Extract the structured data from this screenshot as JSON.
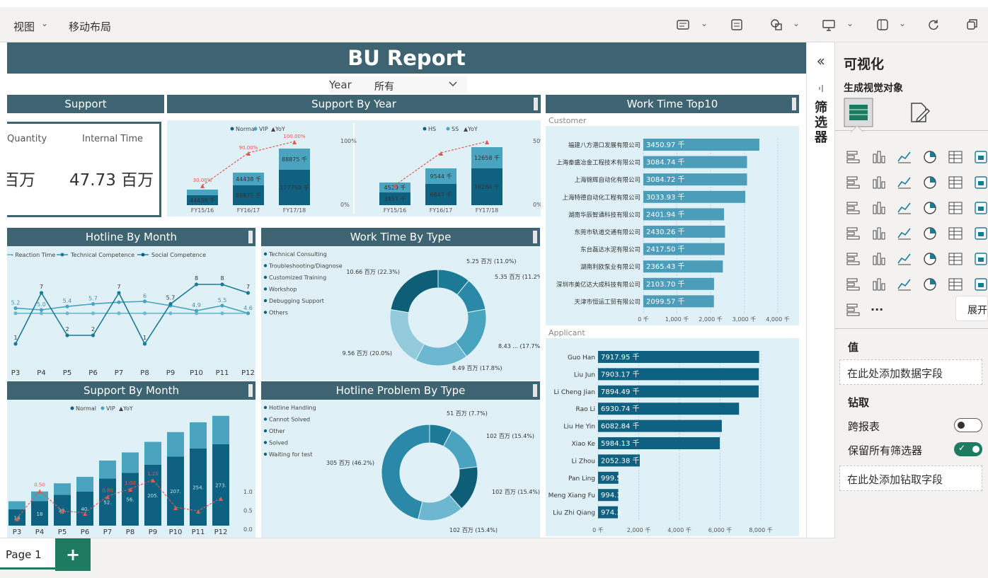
{
  "toolbar": {
    "view_label": "视图",
    "mobile_layout_label": "移动布局"
  },
  "report": {
    "title": "BU Report",
    "slicer": {
      "label": "Year",
      "value": "所有"
    }
  },
  "support_card": {
    "header": "Support",
    "quantity_label": "Quantity",
    "quantity_value": "百万",
    "internal_label": "Internal Time",
    "internal_value": "47.73 百万"
  },
  "support_by_year": {
    "header": "Support By Year",
    "left": {
      "legend": [
        "Normal",
        "VIP",
        "YoY"
      ],
      "axis_right": [
        "100%",
        "0%"
      ],
      "bar_labels_top": [
        "",
        "44438 千",
        "88875 千"
      ],
      "bar_labels_bottom": [
        "44438 千",
        "88875 千",
        "177750 千"
      ],
      "yoy_labels": [
        "30.00%",
        "90.00%",
        "100.00%"
      ],
      "categories": [
        "FY15/16",
        "FY16/17",
        "FY17/18"
      ]
    },
    "right": {
      "legend": [
        "HS",
        "SS",
        "YoY"
      ],
      "axis_right": [
        "50%",
        "0%"
      ],
      "bar_labels_top": [
        "4529 千",
        "9544 千",
        "12658 千"
      ],
      "bar_labels_bottom": [
        "3457 千",
        "6847 千",
        "10284 千"
      ],
      "categories": [
        "FY15/16",
        "FY16/17",
        "FY17/18"
      ]
    }
  },
  "worktime_top10": {
    "header": "Work Time Top10",
    "customer_label": "Customer",
    "customers": [
      {
        "name": "福建八方港口发展有限公司",
        "value": 3450.97,
        "label": "3450.97 千"
      },
      {
        "name": "上海秦盛冶金工程技术有限公司",
        "value": 3084.74,
        "label": "3084.74 千"
      },
      {
        "name": "上海锦辉自动化有限公司",
        "value": 3084.72,
        "label": "3084.72 千"
      },
      {
        "name": "上海特德自动化工程有限公司",
        "value": 3033.93,
        "label": "3033.93 千"
      },
      {
        "name": "湖南华辰智通科技有限公司",
        "value": 2401.94,
        "label": "2401.94 千"
      },
      {
        "name": "东莞市轨道交通有限公司",
        "value": 2430.26,
        "label": "2430.26 千"
      },
      {
        "name": "东台磊达水泥有限公司",
        "value": 2417.5,
        "label": "2417.50 千"
      },
      {
        "name": "湖南利欧泵业有限公司",
        "value": 2365.43,
        "label": "2365.43 千"
      },
      {
        "name": "深圳市美亿达大成科技有限公司",
        "value": 2103.7,
        "label": "2103.70 千"
      },
      {
        "name": "天津市恒运工贸有限公司",
        "value": 2099.57,
        "label": "2099.57 千"
      }
    ],
    "customer_axis": [
      "0 千",
      "1,000 千",
      "2,000 千",
      "3,000 千",
      "4,000 千"
    ],
    "applicant_label": "Applicant",
    "applicants": [
      {
        "name": "Guo Han",
        "value": 7917.95,
        "label": "7917.95 千"
      },
      {
        "name": "Liu Jun",
        "value": 7903.17,
        "label": "7903.17 千"
      },
      {
        "name": "Li Cheng Jian",
        "value": 7894.49,
        "label": "7894.49 千"
      },
      {
        "name": "Rao Li",
        "value": 6930.74,
        "label": "6930.74 千"
      },
      {
        "name": "Liu He Yin",
        "value": 6082.84,
        "label": "6082.84 千"
      },
      {
        "name": "Xiao Ke",
        "value": 5984.13,
        "label": "5984.13 千"
      },
      {
        "name": "Li Zhou",
        "value": 2052.38,
        "label": "2052.38 千"
      },
      {
        "name": "Pan Ling",
        "value": 999.5,
        "label": "999.5"
      },
      {
        "name": "Meng Xiang Fu",
        "value": 994.1,
        "label": "994.1"
      },
      {
        "name": "Liu Zhi Qiang",
        "value": 974.3,
        "label": "974.3"
      }
    ],
    "applicant_axis": [
      "0 千",
      "2,000 千",
      "4,000 千",
      "6,000 千",
      "8,000 千"
    ]
  },
  "hotline_by_month": {
    "header": "Hotline By Month",
    "legend": [
      "Reaction Time",
      "Technical Competence",
      "Social Competence"
    ],
    "categories": [
      "P3",
      "P4",
      "P5",
      "P6",
      "P7",
      "P8",
      "P9",
      "P10",
      "P11",
      "P12"
    ],
    "series_a": [
      1,
      7,
      2,
      2,
      7,
      1,
      5.7,
      8,
      8,
      7
    ],
    "series_b": [
      5.2,
      5.0,
      5.4,
      5.7,
      5.9,
      6,
      5.5,
      4.9,
      5.5,
      4.6
    ],
    "series_c": [
      4.6,
      4.6,
      4.6,
      4.6,
      4.6,
      4.6,
      4.6,
      4.6,
      4.6,
      4.6
    ],
    "labels_a": [
      "1",
      "7",
      "2",
      "2",
      "7",
      "1",
      "5.7",
      "8",
      "8",
      "7"
    ],
    "labels_b": [
      "5.2",
      "5.0",
      "5.4",
      "5.7",
      "",
      "6",
      "",
      "4.9",
      "5.5",
      "4.6"
    ]
  },
  "worktime_by_type": {
    "header": "Work Time By Type",
    "legend": [
      "Technical Consulting",
      "Troubleshooting/Diagnose",
      "Customized Training",
      "Workshop",
      "Debugging Support",
      "Others"
    ],
    "values": [
      11.0,
      11.2,
      17.7,
      17.8,
      20.0,
      22.3
    ],
    "colors": [
      "#1b7a96",
      "#2a89a6",
      "#4aa3bf",
      "#6db8d0",
      "#93cbdc",
      "#0f5e78"
    ],
    "labels": [
      "5.25 百万 (11.0%)",
      "5.35 百万 (11.2%)",
      "8.43 ... (17.7%)",
      "8.49 百万 (17.8%)",
      "9.56 百万 (20.0%)",
      "10.66 百万 (22.3%)"
    ]
  },
  "support_by_month": {
    "header": "Support By Month",
    "legend": [
      "Normal",
      "VIP",
      "YoY"
    ],
    "categories": [
      "P3",
      "P4",
      "P5",
      "P6",
      "P7",
      "P8",
      "P9",
      "P10",
      "P11",
      "P12"
    ],
    "normal": [
      20,
      30,
      38,
      42,
      58,
      65,
      75,
      85,
      95,
      100
    ],
    "vip": [
      10,
      12,
      14,
      18,
      22,
      25,
      28,
      30,
      32,
      35
    ],
    "yoy": [
      0.2,
      0.95,
      0.4,
      0.35,
      0.8,
      1.0,
      1.25,
      0.5,
      0.4,
      0.75
    ],
    "yoy_labels": [
      "",
      "0.50",
      "",
      "",
      "0.80",
      "1.00",
      "1.25",
      "",
      "",
      ""
    ],
    "axis_right": [
      "1.0",
      "0.5",
      "0.0"
    ],
    "bar_small_labels": [
      "14",
      "18",
      "38.",
      "40.",
      "52.",
      "56.",
      "205.",
      "207.",
      "254.",
      "273."
    ]
  },
  "hotline_problem_by_type": {
    "header": "Hotline Problem By Type",
    "legend": [
      "Hotline Handling",
      "Cannot Solved",
      "Other",
      "Solved",
      "Waiting for test"
    ],
    "values": [
      7.7,
      15.4,
      15.4,
      15.4,
      46.2
    ],
    "colors": [
      "#1b7a96",
      "#4aa3bf",
      "#0f5e78",
      "#6db8d0",
      "#2a89a6"
    ],
    "labels": [
      "51 百万 (7.7%)",
      "102 百万 (15.4%)",
      "102 百万 (15.4%)",
      "102 百万 (15.4%)",
      "305 百万 (46.2%)"
    ]
  },
  "filter_pane": {
    "label": "筛选器"
  },
  "viz_pane": {
    "title": "可视化",
    "subtitle": "生成视觉对象",
    "values_label": "值",
    "values_placeholder": "在此处添加数据字段",
    "drill_label": "钻取",
    "cross_report_label": "跨报表",
    "keep_filters_label": "保留所有筛选器",
    "drill_placeholder": "在此处添加钻取字段",
    "expand_label": "展开",
    "more_label": "..."
  },
  "pages": {
    "tab_label": "Page 1",
    "add_label": "+"
  }
}
